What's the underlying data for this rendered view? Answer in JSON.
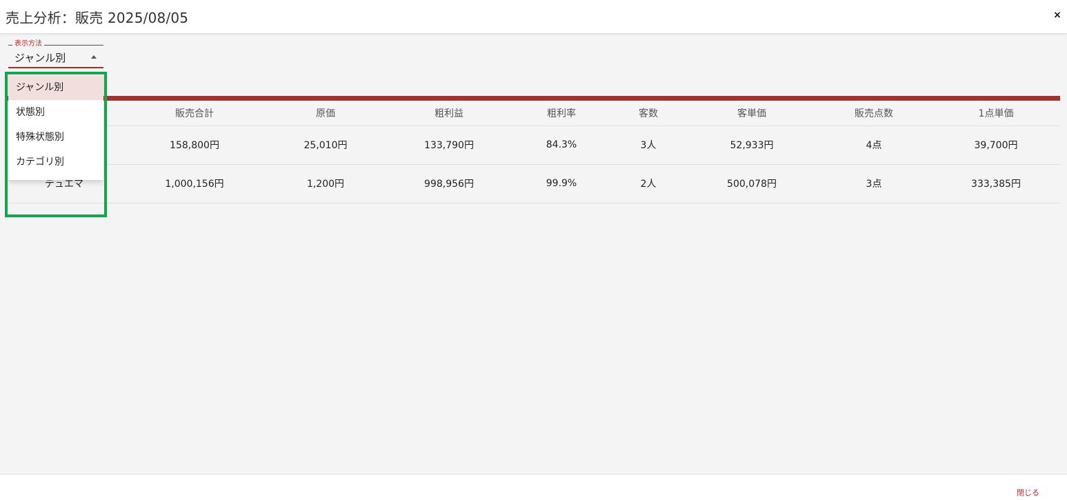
{
  "header": {
    "title": "売上分析：販売 2025/08/05",
    "close_icon": "×"
  },
  "display_mode": {
    "label": "表示方法",
    "selected": "ジャンル別",
    "options": [
      "ジャンル別",
      "状態別",
      "特殊状態別",
      "カテゴリ別"
    ]
  },
  "table": {
    "columns": [
      "",
      "販売合計",
      "原価",
      "粗利益",
      "粗利率",
      "客数",
      "客単価",
      "販売点数",
      "1点単価"
    ],
    "rows": [
      [
        "",
        "158,800円",
        "25,010円",
        "133,790円",
        "84.3%",
        "3人",
        "52,933円",
        "4点",
        "39,700円"
      ],
      [
        "デュエマ",
        "1,000,156円",
        "1,200円",
        "998,956円",
        "99.9%",
        "2人",
        "500,078円",
        "3点",
        "333,385円"
      ]
    ]
  },
  "footer": {
    "close_label": "閉じる"
  },
  "colors": {
    "accent": "#b22a2a",
    "highlight": "#10a84a",
    "selected_option_bg": "#f3dede"
  }
}
